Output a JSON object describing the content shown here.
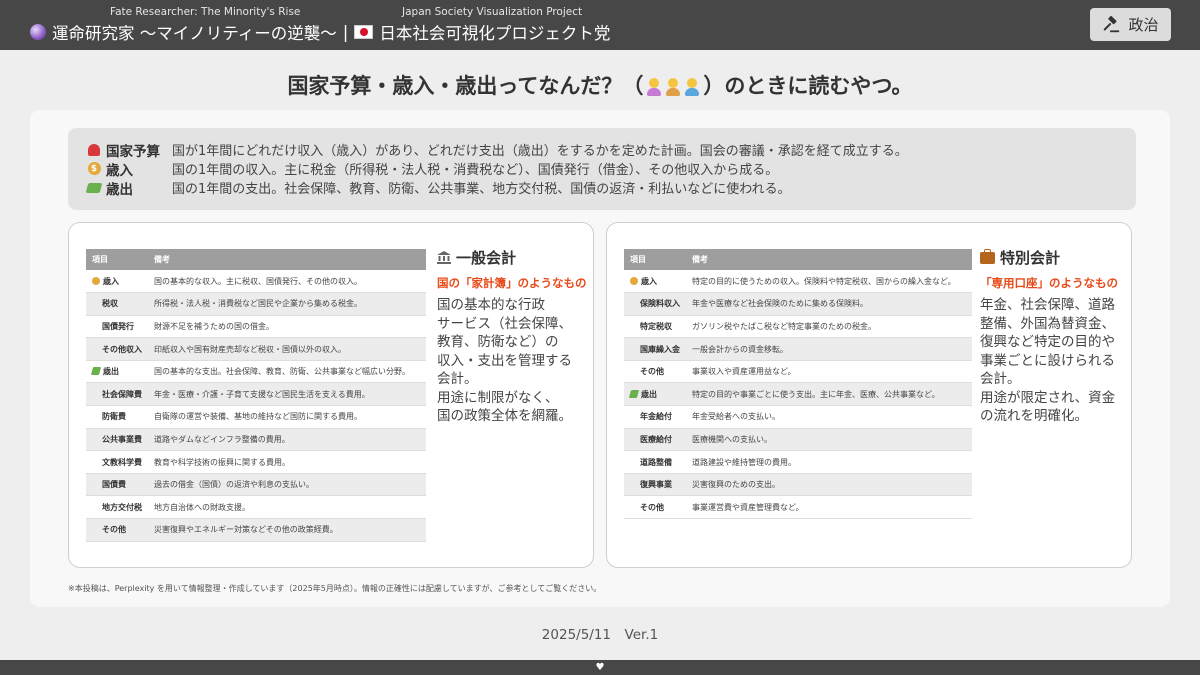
{
  "header": {
    "subtitle_en": "Fate Researcher: The Minority's Rise",
    "subtitle_project": "Japan Society Visualization Project",
    "title_jp": "運命研究家 〜マイノリティーの逆襲〜",
    "separator": "|",
    "project_jp": "日本社会可視化プロジェクト党",
    "politics_button": "政治"
  },
  "page_title_before": "国家予算・歳入・歳出ってなんだ？（",
  "page_title_after": "）のときに読むやつ。",
  "definitions": [
    {
      "icon": "budget-icon",
      "term": "国家予算",
      "desc": "国が1年間にどれだけ収入（歳入）があり、どれだけ支出（歳出）をするかを定めた計画。国会の審議・承認を経て成立する。"
    },
    {
      "icon": "money-bag-icon",
      "term": "歳入",
      "desc": "国の1年間の収入。主に税金（所得税・法人税・消費税など）、国債発行（借金）、その他収入から成る。"
    },
    {
      "icon": "money-outflow-icon",
      "term": "歳出",
      "desc": "国の1年間の支出。社会保障、教育、防衛、公共事業、地方交付税、国債の返済・利払いなどに使われる。"
    }
  ],
  "general": {
    "table_header": [
      "項目",
      "備考"
    ],
    "rows": [
      {
        "item": "歳入",
        "note": "国の基本的な収入。主に税収、国債発行、その他の収入。",
        "icon": "in"
      },
      {
        "item": "税収",
        "note": "所得税・法人税・消費税など国民や企業から集める税金。"
      },
      {
        "item": "国債発行",
        "note": "財源不足を補うための国の借金。"
      },
      {
        "item": "その他収入",
        "note": "印紙収入や国有財産売却など税収・国債以外の収入。"
      },
      {
        "item": "歳出",
        "note": "国の基本的な支出。社会保障、教育、防衛、公共事業など幅広い分野。",
        "icon": "out"
      },
      {
        "item": "社会保障費",
        "note": "年金・医療・介護・子育て支援など国民生活を支える費用。"
      },
      {
        "item": "防衛費",
        "note": "自衛隊の運営や装備、基地の維持など国防に関する費用。"
      },
      {
        "item": "公共事業費",
        "note": "道路やダムなどインフラ整備の費用。"
      },
      {
        "item": "文教科学費",
        "note": "教育や科学技術の振興に関する費用。"
      },
      {
        "item": "国債費",
        "note": "過去の借金（国債）の返済や利息の支払い。"
      },
      {
        "item": "地方交付税",
        "note": "地方自治体への財政支援。"
      },
      {
        "item": "その他",
        "note": "災害復興やエネルギー対策などその他の政策経費。"
      }
    ],
    "heading": "一般会計",
    "tag": "国の「家計簿」のようなもの",
    "body_lines": [
      "国の基本的な行政",
      "サービス（社会保障、",
      "教育、防衛など）の",
      "収入・支出を管理する",
      "会計。",
      "用途に制限がなく、",
      "国の政策全体を網羅。"
    ]
  },
  "special": {
    "table_header": [
      "項目",
      "備考"
    ],
    "rows": [
      {
        "item": "歳入",
        "note": "特定の目的に使うための収入。保険料や特定税収、国からの繰入金など。",
        "icon": "in"
      },
      {
        "item": "保険料収入",
        "note": "年金や医療など社会保険のために集める保険料。"
      },
      {
        "item": "特定税収",
        "note": "ガソリン税やたばこ税など特定事業のための税金。"
      },
      {
        "item": "国庫繰入金",
        "note": "一般会計からの資金移転。"
      },
      {
        "item": "その他",
        "note": "事業収入や資産運用益など。"
      },
      {
        "item": "歳出",
        "note": "特定の目的や事業ごとに使う支出。主に年金、医療、公共事業など。",
        "icon": "out"
      },
      {
        "item": "年金給付",
        "note": "年金受給者への支払い。"
      },
      {
        "item": "医療給付",
        "note": "医療機関への支払い。"
      },
      {
        "item": "道路整備",
        "note": "道路建設や維持管理の費用。"
      },
      {
        "item": "復興事業",
        "note": "災害復興のための支出。"
      },
      {
        "item": "その他",
        "note": "事業運営費や資産管理費など。"
      }
    ],
    "heading": "特別会計",
    "tag": "「専用口座」のようなもの",
    "body_lines": [
      "年金、社会保障、道路",
      "整備、外国為替資金、",
      "復興など特定の目的や",
      "事業ごとに設けられる",
      "会計。",
      "用途が限定され、資金",
      "の流れを明確化。"
    ]
  },
  "footnote": "※本投稿は、Perplexity を用いて情報整理・作成しています（2025年5月時点）。情報の正確性には配慮していますが、ご参考としてご覧ください。",
  "date_version": "2025/5/11　Ver.1"
}
